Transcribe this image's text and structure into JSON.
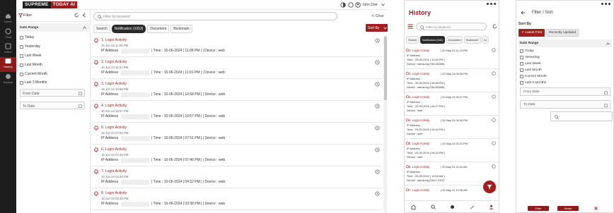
{
  "rail": {
    "items": [
      {
        "label": "Home",
        "icon": "home-icon",
        "active": false
      },
      {
        "label": "Chat",
        "icon": "chat-icon",
        "active": false
      },
      {
        "label": "Editor",
        "icon": "editor-icon",
        "active": false
      },
      {
        "label": "History",
        "icon": "history-icon",
        "active": true
      },
      {
        "label": "Explore",
        "icon": "explore-icon",
        "active": false
      }
    ]
  },
  "header": {
    "logo_a": "SUPREME",
    "logo_b": "TODAY AI",
    "user": "John Doe"
  },
  "filter": {
    "title": "Filter",
    "date_range": "Date Range",
    "options": [
      "Today",
      "Yesterday",
      "Last Week",
      "Last Month",
      "Current Month",
      "Last 3 Months"
    ],
    "from_date": "From Date",
    "to_date": "To Date"
  },
  "main": {
    "search_placeholder": "Filter by keyword",
    "clear": "Clear",
    "tabs": [
      "Search",
      "Notification (1053)",
      "Document",
      "Bookmark"
    ],
    "sort_label": "Sort By",
    "items": [
      {
        "title": "1. Login Activity",
        "time": "15 Jun 24 11:08 PM",
        "ip": "IP Address",
        "detail": "|   Time : 15-06-2024 | 11:08 PM |   |   Device : web"
      },
      {
        "title": "2. Login Activity",
        "time": "15 Jun 24 11:01 PM",
        "ip": "IP Address",
        "detail": "|   Time : 15-06-2024 | 11:01 PM |   |   Device : web"
      },
      {
        "title": "3. Login Activity",
        "time": "15 Jun 24 10:58 PM",
        "ip": "IP Address",
        "detail": "|   Time : 15-06-2024 | 10:58 PM |   |   Device : web"
      },
      {
        "title": "4. Login Activity",
        "time": "15 Jun 24 10:57 PM",
        "ip": "IP Address",
        "detail": "|   Time : 15-06-2024 | 10:57 PM |   |   Device : web"
      },
      {
        "title": "5. Login Activity",
        "time": "15 Jun 24 07:51 PM",
        "ip": "IP Address",
        "detail": "|   Time : 15-06-2024 | 07:51 PM |   |   Device : web"
      },
      {
        "title": "6. Login Activity",
        "time": "15 Jun 24 07:46 PM",
        "ip": "IP Address",
        "detail": "|   Time : 15-06-2024 | 07:46 PM |   |   Device : web"
      },
      {
        "title": "7. Login Activity",
        "time": "15 Jun 24 04:32 PM",
        "ip": "IP Address",
        "detail": "|   Time : 15-06-2024 | 04:32 PM |   |   Device : web"
      },
      {
        "title": "8. Login Activity",
        "time": "15 Jun 24 03:38 PM",
        "ip": "IP Address",
        "detail": "|   Time : 15-06-2024 | 03:38 PM |   |   Device : web"
      }
    ]
  },
  "mobile_history": {
    "title": "History",
    "search_placeholder": "Filter by keyword",
    "tabs": [
      "Search",
      "Notification (641)",
      "Document",
      "Bookmark",
      "Lo"
    ],
    "items": [
      {
        "title": "1. Login Activity",
        "date": "| 20 May 24 11:19 PM",
        "ip": "IP Address :",
        "time": "Time : 20-05-2024 ( 11:53 PM )",
        "device": "Device : samsung (SM-A536B)"
      },
      {
        "title": "2. Login Activity",
        "date": "| 20 May 24 06:58 PM",
        "ip": "IP Address :",
        "time": "Time : 20-05-2024 ( 06:58 PM )",
        "device": "Device : samsung (SM-A536B)"
      },
      {
        "title": "3. Login Activity",
        "date": "| 20 May 24 05:27 PM",
        "ip": "IP Address :",
        "time": "Time : 20-05-2024 ( 05:27 PM )",
        "device": "Device : web"
      },
      {
        "title": "4. Login Activity",
        "date": "| 20 May 24 04:54 PM",
        "ip": "IP Address :",
        "time": "Time : 20-05-2024 ( 04:54 PM )",
        "device": "Device : web"
      },
      {
        "title": "5. Login Activity",
        "date": "| 20 May 24 04:22 PM",
        "ip": "IP Address :",
        "time": "Time : 20-05-2024 ( 04:22 PM )",
        "device": "Device : web"
      },
      {
        "title": "6. Login Activity",
        "date": "| 20 May 24 11:54 AM",
        "ip": "IP Address :",
        "time": "Time : 20-05-2024 ( 11:54 AM )",
        "device": "Device : samsung (SM-C701F)"
      },
      {
        "title": "7. Login Activity",
        "date": "| 20 May 24 10:38 AM",
        "ip": "",
        "time": "",
        "device": ""
      }
    ]
  },
  "mobile_filter": {
    "title": "Filter / Sort",
    "sort_by": "Sort By",
    "latest_first": "✓ Latest First",
    "recently_updated": "Recently Updated",
    "date_range": "Date Range",
    "options": [
      "Today",
      "Yesterday",
      "Last Week",
      "Last Month",
      "Current Month",
      "Last 3 Months"
    ],
    "from_date": "From Date",
    "to_date": "To Date",
    "filter_btn": "Filter",
    "reset_btn": "Reset"
  },
  "colors": {
    "accent": "#a31e1e",
    "rail": "#1d1d1d",
    "active_tab": "#2a2a2a"
  }
}
